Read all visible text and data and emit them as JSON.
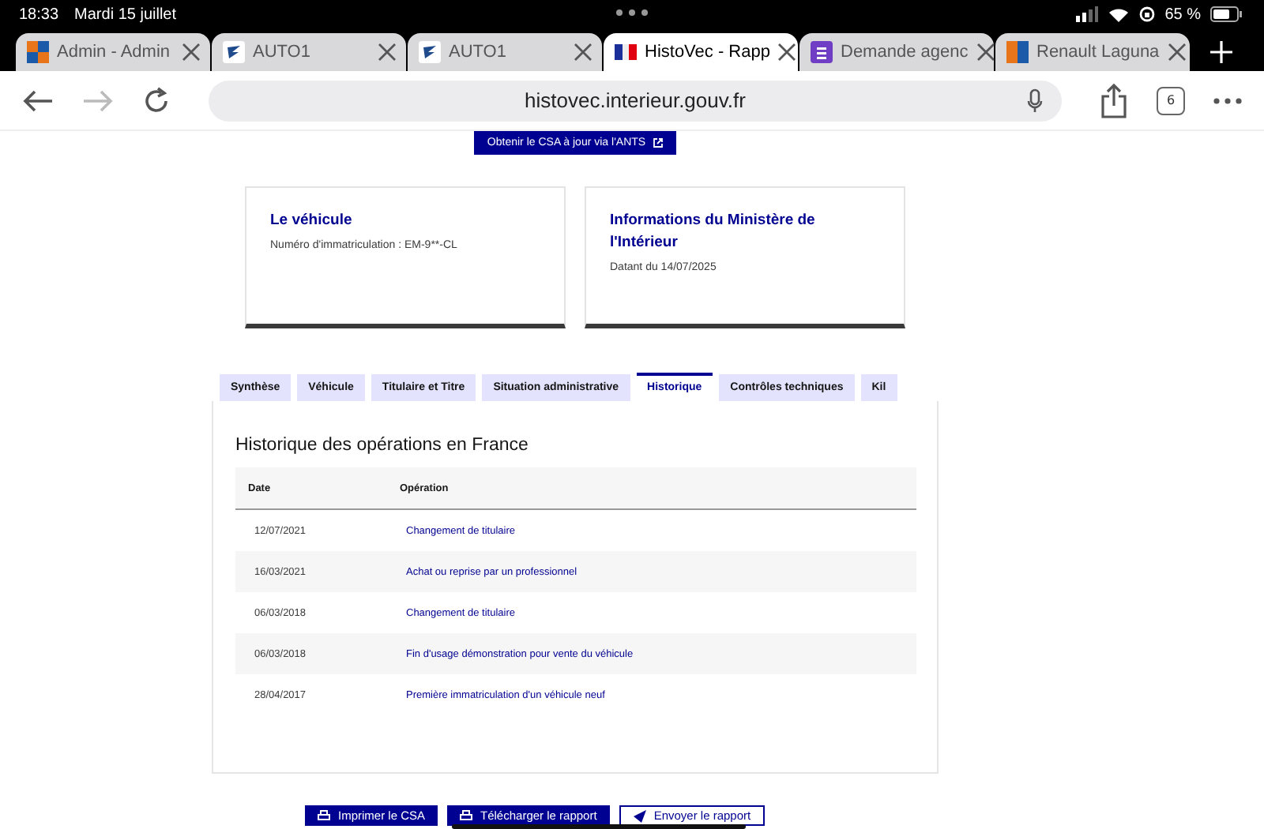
{
  "status_bar": {
    "time": "18:33",
    "date": "Mardi 15 juillet",
    "battery": "65 %"
  },
  "browser_tabs": [
    {
      "title": "Admin - Admin",
      "kind": "grid",
      "selected": false
    },
    {
      "title": "AUTO1",
      "kind": "auto",
      "selected": false
    },
    {
      "title": "AUTO1",
      "kind": "auto",
      "selected": false
    },
    {
      "title": "HistoVec - Rapp",
      "kind": "flag",
      "selected": true
    },
    {
      "title": "Demande agenc",
      "kind": "form",
      "selected": false
    },
    {
      "title": "Renault Laguna",
      "kind": "square",
      "selected": false
    }
  ],
  "address_bar": {
    "url": "histovec.interieur.gouv.fr",
    "tab_count": "6"
  },
  "csa_button": "Obtenir le CSA à jour via l'ANTS",
  "cards": [
    {
      "title": "Le véhicule",
      "text": "Numéro d'immatriculation : EM-9**-CL"
    },
    {
      "title": "Informations du Ministère de l'Intérieur",
      "text": "Datant du 14/07/2025"
    }
  ],
  "tabs": [
    {
      "label": "Synthèse",
      "selected": false
    },
    {
      "label": "Véhicule",
      "selected": false
    },
    {
      "label": "Titulaire et Titre",
      "selected": false
    },
    {
      "label": "Situation administrative",
      "selected": false
    },
    {
      "label": "Historique",
      "selected": true
    },
    {
      "label": "Contrôles techniques",
      "selected": false
    },
    {
      "label": "Kil",
      "selected": false
    }
  ],
  "panel": {
    "heading": "Historique des opérations en France",
    "table": {
      "columns": [
        "Date",
        "Opération"
      ],
      "rows": [
        {
          "date": "12/07/2021",
          "operation": "Changement de titulaire"
        },
        {
          "date": "16/03/2021",
          "operation": "Achat ou reprise par un professionnel"
        },
        {
          "date": "06/03/2018",
          "operation": "Changement de titulaire"
        },
        {
          "date": "06/03/2018",
          "operation": "Fin d'usage démonstration pour vente du véhicule"
        },
        {
          "date": "28/04/2017",
          "operation": "Première immatriculation d'un véhicule neuf"
        }
      ]
    }
  },
  "actions": [
    {
      "label": "Imprimer le CSA",
      "kind": "primary"
    },
    {
      "label": "Télécharger le rapport",
      "kind": "primary"
    },
    {
      "label": "Envoyer le rapport",
      "kind": "secondary"
    }
  ]
}
